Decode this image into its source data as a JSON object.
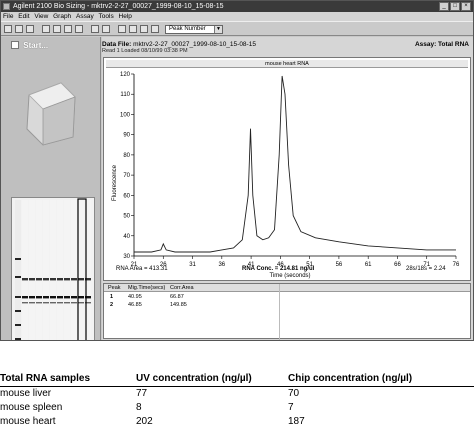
{
  "window": {
    "title": "Agilent 2100 Bio Sizing - mktrv2-2-27_00027_1999-08-10_15-08-15"
  },
  "menu": [
    "File",
    "Edit",
    "View",
    "Graph",
    "Assay",
    "Tools",
    "Help"
  ],
  "toolbar": {
    "peak_select": "Peak Number"
  },
  "left_panel": {
    "start_label": "Start..."
  },
  "header": {
    "data_file_label": "Data File:",
    "data_file_value": "mktrv2-2-27_00027_1999-08-10_15-08-15",
    "loaded_text": "Read 1 Loaded  08/10/99 03:38 PM",
    "assay_label": "Assay: Total RNA"
  },
  "electropherogram": {
    "title": "mouse heart RNA",
    "ylabel": "Fluorescence",
    "xlabel": "Time (seconds)"
  },
  "stats": {
    "rna_area": "RNA Area = 413.31",
    "rna_conc": "RNA Conc. = 214.81 ng/ul",
    "ratio": "28s/18s = 2.24"
  },
  "peak_table": {
    "headers": [
      "Peak",
      "Mig.Time(secs)",
      "Corr.Area"
    ],
    "rows": [
      [
        "1",
        "40.95",
        "66.87"
      ],
      [
        "2",
        "46.85",
        "149.85"
      ]
    ]
  },
  "chart_data": {
    "type": "line",
    "title": "mouse heart RNA",
    "xlabel": "Time (seconds)",
    "ylabel": "Fluorescence",
    "xlim": [
      21,
      76
    ],
    "ylim": [
      30,
      120
    ],
    "x_ticks": [
      21,
      26,
      31,
      36,
      41,
      46,
      51,
      56,
      61,
      66,
      71,
      76
    ],
    "y_ticks": [
      30,
      40,
      50,
      60,
      70,
      80,
      90,
      100,
      110,
      120
    ],
    "series": [
      {
        "x": [
          21,
          24,
          25.6,
          26,
          26.5,
          28,
          31,
          34,
          36,
          38,
          39.5,
          40.5,
          40.9,
          41.3,
          42,
          43,
          44,
          45,
          45.8,
          46.3,
          46.8,
          47.4,
          48.2,
          49.5,
          52,
          56,
          61,
          66,
          71,
          76
        ],
        "y": [
          32,
          32,
          33,
          36,
          33,
          32,
          32,
          32,
          33,
          34,
          38,
          60,
          93,
          60,
          40,
          38,
          39,
          43,
          80,
          119,
          110,
          75,
          50,
          42,
          39,
          37,
          35,
          34,
          33,
          33
        ]
      }
    ]
  },
  "samples_table": {
    "headers": [
      "Total RNA samples",
      "UV concentration (ng/µl)",
      "Chip concentration (ng/µl)"
    ],
    "rows": [
      [
        "mouse liver",
        "77",
        "70"
      ],
      [
        "mouse spleen",
        "8",
        "7"
      ],
      [
        "mouse heart",
        "202",
        "187"
      ]
    ]
  }
}
